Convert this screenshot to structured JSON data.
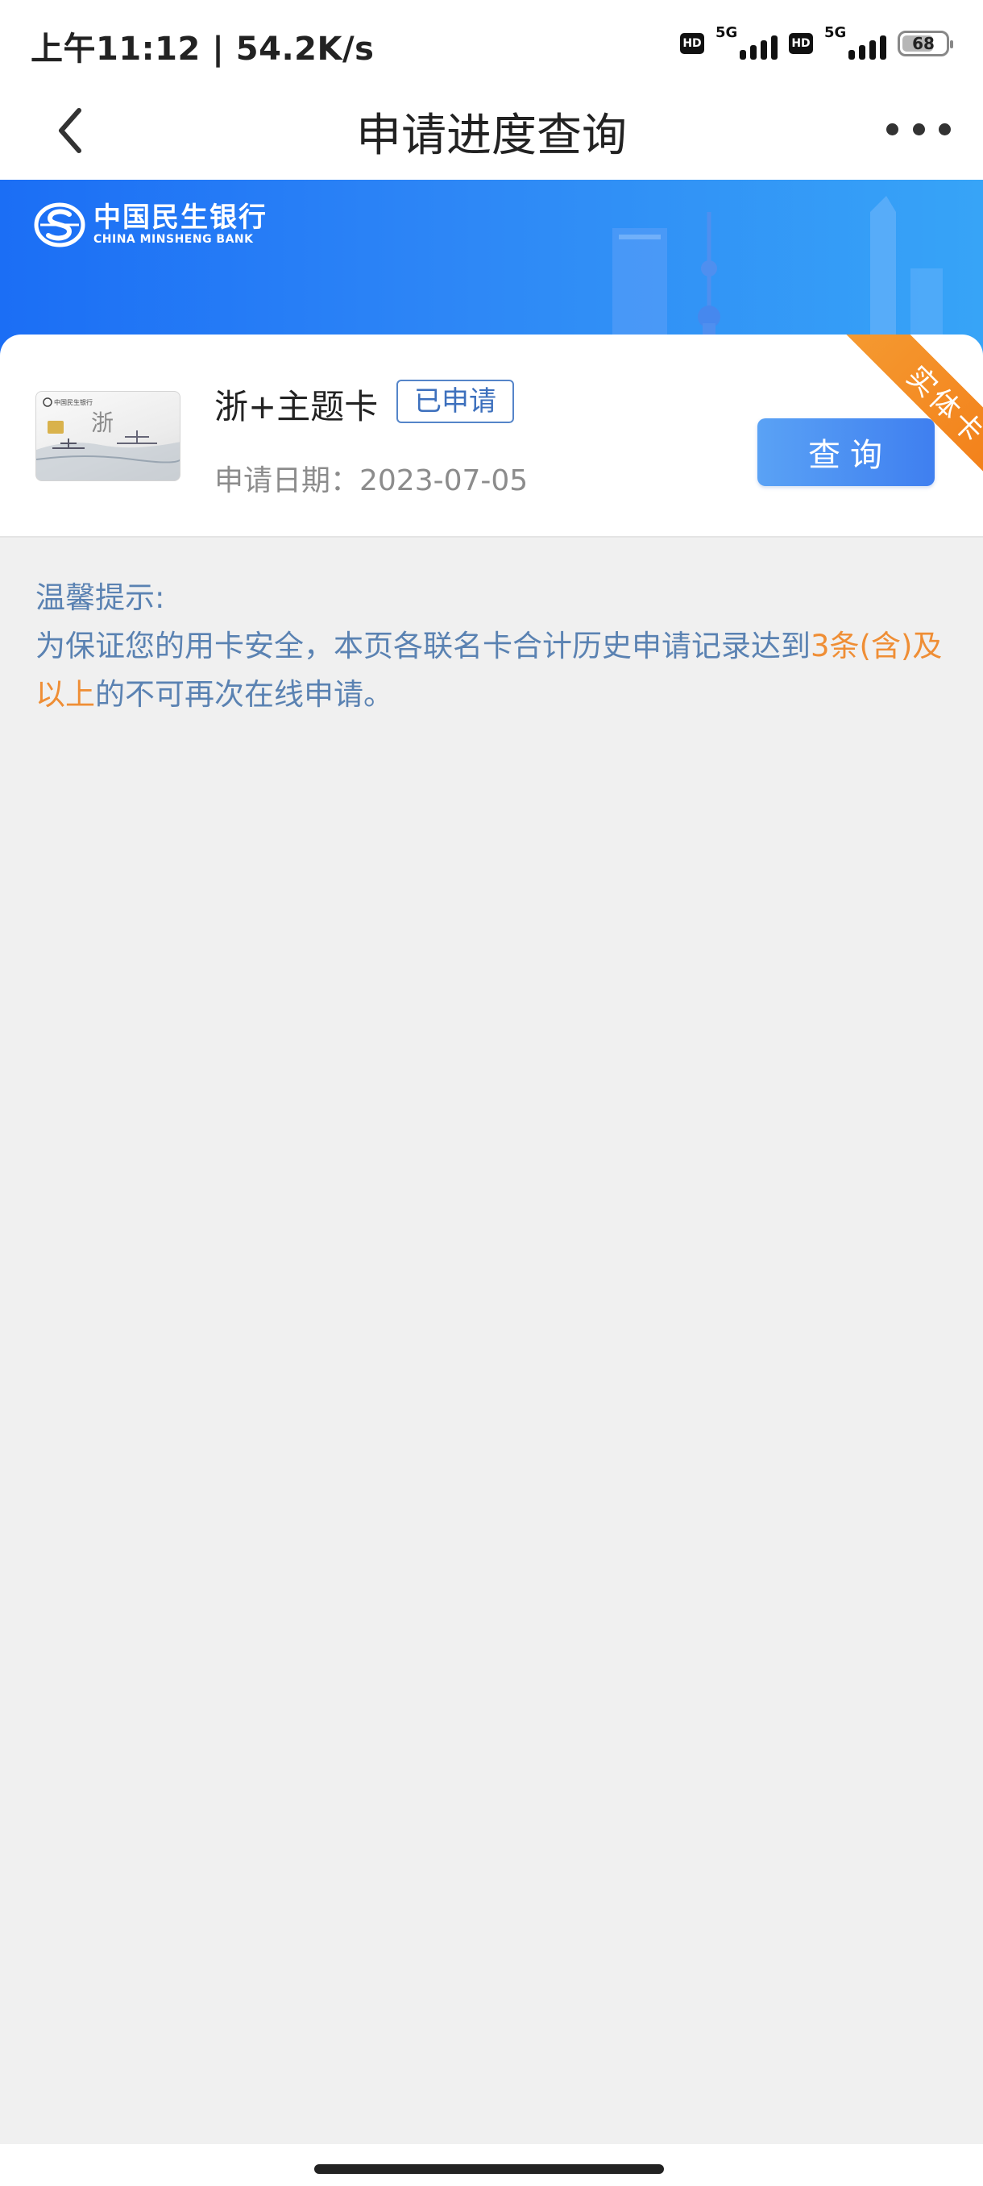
{
  "status_bar": {
    "time": "上午11:12 | 54.2K/s",
    "sim1": {
      "hd": "HD",
      "network": "5G"
    },
    "sim2": {
      "hd": "HD",
      "network": "5G"
    },
    "battery": "68"
  },
  "nav": {
    "title": "申请进度查询"
  },
  "banner": {
    "bank_name_cn": "中国民生银行",
    "bank_name_en": "CHINA MINSHENG BANK",
    "brand_color": "#1b6ef5"
  },
  "card": {
    "name": "浙+主题卡",
    "status_tag": "已申请",
    "apply_date": "申请日期：2023-07-05",
    "query_button": "查询",
    "ribbon": "实体卡",
    "thumb_brand": "中国民生银行",
    "thumb_char": "浙"
  },
  "tips": {
    "title": "温馨提示:",
    "body_part1": "为保证您的用卡安全，本页各联名卡合计历史申请记录达到",
    "body_highlight": "3条(含)及以上",
    "body_part2": "的不可再次在线申请。",
    "highlight_color": "#ef8e35"
  }
}
